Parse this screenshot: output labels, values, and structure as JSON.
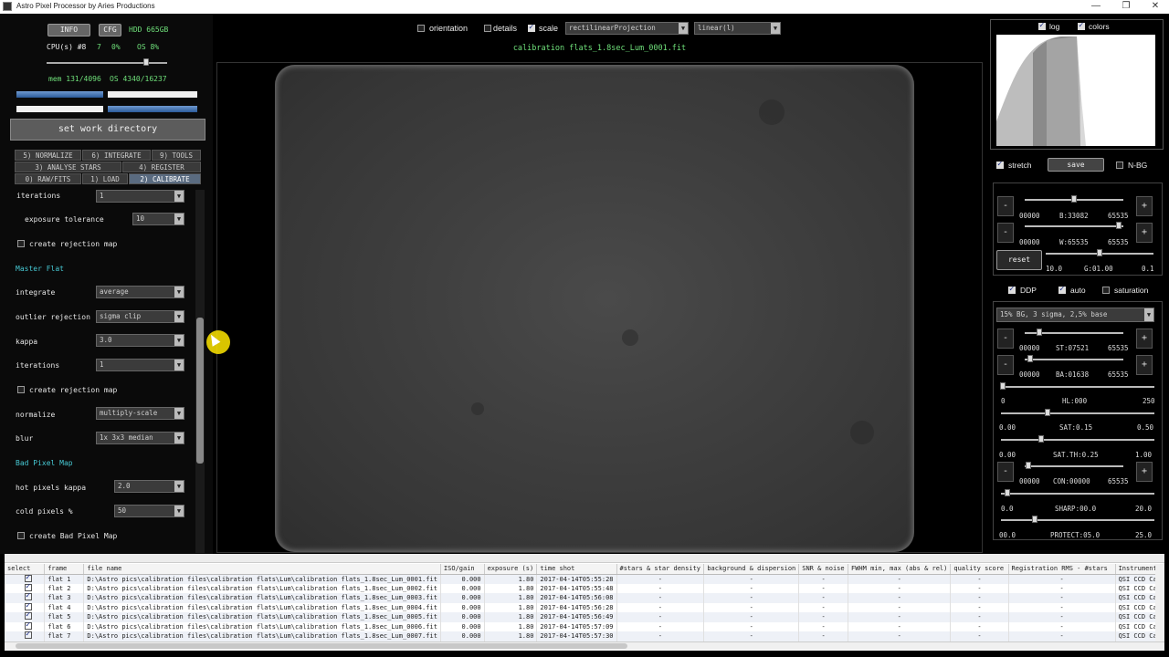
{
  "window": {
    "title": "Astro Pixel Processor by Aries Productions"
  },
  "status": {
    "info_button": "INFO",
    "cfg_button": "CFG",
    "hdd": "HDD 665GB",
    "cpu_label": "CPU(s) #8",
    "cpu_value": "7",
    "cpu_pct": "0%",
    "os_label": "OS 8%",
    "mem": "mem 131/4096",
    "os_mem": "OS 4340/16237"
  },
  "workdir_button": "set work directory",
  "tabs": {
    "normalize": "5) NORMALIZE",
    "integrate": "6) INTEGRATE",
    "tools": "9) TOOLS",
    "analyse": "3) ANALYSE STARS",
    "register": "4) REGISTER",
    "raw": "0) RAW/FITS",
    "load": "1) LOAD",
    "calibrate": "2) CALIBRATE"
  },
  "settings": {
    "iterations_top_label": "iterations",
    "iterations_top_value": "1",
    "exposure_tolerance_label": "exposure tolerance",
    "exposure_tolerance_value": "10",
    "create_rejection_map_1": "create rejection map",
    "master_flat": "Master Flat",
    "integrate_label": "integrate",
    "integrate_value": "average",
    "outlier_label": "outlier rejection",
    "outlier_value": "sigma clip",
    "kappa_label": "kappa",
    "kappa_value": "3.0",
    "iterations_label": "iterations",
    "iterations_value": "1",
    "create_rejection_map_2": "create rejection map",
    "normalize_label": "normalize",
    "normalize_value": "multiply-scale",
    "blur_label": "blur",
    "blur_value": "1x 3x3 median",
    "bad_pixel_map": "Bad Pixel Map",
    "hot_kappa_label": "hot pixels kappa",
    "hot_kappa_value": "2.0",
    "cold_pct_label": "cold pixels %",
    "cold_pct_value": "50",
    "create_bpm": "create Bad Pixel Map"
  },
  "toolbar": {
    "orientation": "orientation",
    "details": "details",
    "scale": "scale",
    "projection": "rectilinearProjection",
    "stretch_mode": "linear(l)",
    "file_title": "calibration flats_1.8sec_Lum_0001.fit"
  },
  "right": {
    "log": "log",
    "colors": "colors",
    "stretch": "stretch",
    "save": "save",
    "nbg": "N-BG",
    "minus": "-",
    "plus": "+",
    "b_min": "00000",
    "b_label": "B:33082",
    "b_max": "65535",
    "w_min": "00000",
    "w_label": "W:65535",
    "w_max": "65535",
    "reset": "reset",
    "g_min": "10.0",
    "g_label": "G:01.00",
    "g_max": "0.1",
    "ddp": "DDP",
    "auto": "auto",
    "saturation": "saturation",
    "preset": "15% BG, 3 sigma, 2,5% base",
    "st_min": "00000",
    "st_label": "ST:07521",
    "st_max": "65535",
    "ba_min": "00000",
    "ba_label": "BA:01638",
    "ba_max": "65535",
    "hl_min": "0",
    "hl_label": "HL:000",
    "hl_max": "250",
    "sat_min": "0.00",
    "sat_label": "SAT:0.15",
    "sat_max": "0.50",
    "satth_min": "0.00",
    "satth_label": "SAT.TH:0.25",
    "satth_max": "1.00",
    "con_min": "00000",
    "con_label": "CON:00000",
    "con_max": "65535",
    "sharp_min": "0.0",
    "sharp_label": "SHARP:00.0",
    "sharp_max": "20.0",
    "protect_min": "00.0",
    "protect_label": "PROTECT:05.0",
    "protect_max": "25.0"
  },
  "table": {
    "headers": [
      "select",
      "frame",
      "file name",
      "ISO/gain",
      "exposure (s)",
      "time shot",
      "#stars & star density",
      "background & dispersion",
      "SNR & noise",
      "FWHM min, max (abs & rel)",
      "quality score",
      "Registration RMS - #stars",
      "Instrument"
    ],
    "rows": [
      [
        "flat 1",
        "D:\\Astro pics\\calibration files\\calibration flats\\Lum\\calibration flats_1.8sec_Lum_0001.fit",
        "0.000",
        "1.80",
        "2017-04-14T05:55:28",
        "-",
        "-",
        "-",
        "-",
        "-",
        "-",
        "QSI CCD Cam"
      ],
      [
        "flat 2",
        "D:\\Astro pics\\calibration files\\calibration flats\\Lum\\calibration flats_1.8sec_Lum_0002.fit",
        "0.000",
        "1.80",
        "2017-04-14T05:55:48",
        "-",
        "-",
        "-",
        "-",
        "-",
        "-",
        "QSI CCD Cam"
      ],
      [
        "flat 3",
        "D:\\Astro pics\\calibration files\\calibration flats\\Lum\\calibration flats_1.8sec_Lum_0003.fit",
        "0.000",
        "1.80",
        "2017-04-14T05:56:08",
        "-",
        "-",
        "-",
        "-",
        "-",
        "-",
        "QSI CCD Cam"
      ],
      [
        "flat 4",
        "D:\\Astro pics\\calibration files\\calibration flats\\Lum\\calibration flats_1.8sec_Lum_0004.fit",
        "0.000",
        "1.80",
        "2017-04-14T05:56:28",
        "-",
        "-",
        "-",
        "-",
        "-",
        "-",
        "QSI CCD Cam"
      ],
      [
        "flat 5",
        "D:\\Astro pics\\calibration files\\calibration flats\\Lum\\calibration flats_1.8sec_Lum_0005.fit",
        "0.000",
        "1.80",
        "2017-04-14T05:56:49",
        "-",
        "-",
        "-",
        "-",
        "-",
        "-",
        "QSI CCD Cam"
      ],
      [
        "flat 6",
        "D:\\Astro pics\\calibration files\\calibration flats\\Lum\\calibration flats_1.8sec_Lum_0006.fit",
        "0.000",
        "1.80",
        "2017-04-14T05:57:09",
        "-",
        "-",
        "-",
        "-",
        "-",
        "-",
        "QSI CCD Cam"
      ],
      [
        "flat 7",
        "D:\\Astro pics\\calibration files\\calibration flats\\Lum\\calibration flats_1.8sec_Lum_0007.fit",
        "0.000",
        "1.80",
        "2017-04-14T05:57:30",
        "-",
        "-",
        "-",
        "-",
        "-",
        "-",
        "QSI CCD Cam"
      ]
    ]
  }
}
